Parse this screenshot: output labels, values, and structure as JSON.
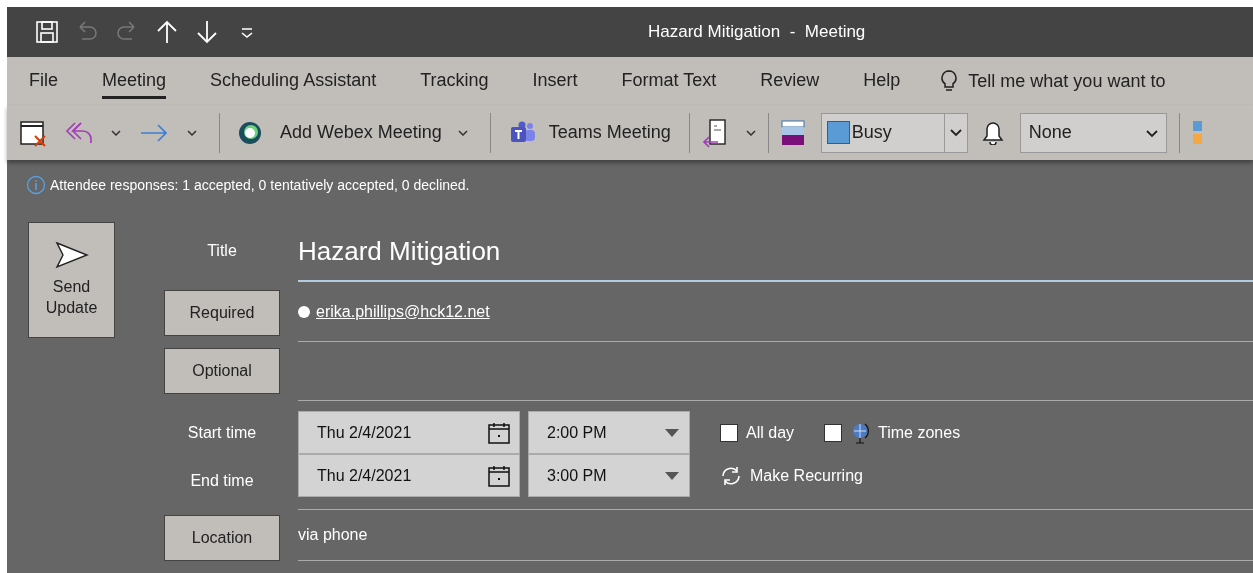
{
  "window": {
    "title": "Hazard Mitigation  -  Meeting"
  },
  "quick_access": [
    {
      "kind": "save",
      "disabled": false
    },
    {
      "kind": "undo",
      "disabled": true
    },
    {
      "kind": "redo",
      "disabled": true
    },
    {
      "kind": "up",
      "disabled": false
    },
    {
      "kind": "down",
      "disabled": false
    },
    {
      "kind": "customize",
      "disabled": false
    }
  ],
  "tabs": [
    {
      "label": "File",
      "selected": false
    },
    {
      "label": "Meeting",
      "selected": true
    },
    {
      "label": "Scheduling Assistant",
      "selected": false
    },
    {
      "label": "Tracking",
      "selected": false
    },
    {
      "label": "Insert",
      "selected": false
    },
    {
      "label": "Format Text",
      "selected": false
    },
    {
      "label": "Review",
      "selected": false
    },
    {
      "label": "Help",
      "selected": false
    }
  ],
  "tell_me": {
    "placeholder": "Tell me what you want to"
  },
  "toolbar": {
    "webex_label": "Add Webex Meeting",
    "teams_label": "Teams Meeting",
    "show_as": {
      "value": "Busy",
      "color": "#5b9bd5"
    },
    "reminder": {
      "value": "None"
    }
  },
  "info_bar": {
    "text": "Attendee responses: 1 accepted, 0 tentatively accepted, 0 declined."
  },
  "form": {
    "send_button": "Send Update",
    "title_label": "Title",
    "title_value": "Hazard Mitigation",
    "required_button": "Required",
    "attendees": [
      "erika.phillips@hck12.net"
    ],
    "optional_button": "Optional",
    "start_label": "Start time",
    "start_date": "Thu 2/4/2021",
    "start_time": "2:00 PM",
    "end_label": "End time",
    "end_date": "Thu 2/4/2021",
    "end_time": "3:00 PM",
    "options": [
      {
        "label": "All day",
        "checked": false,
        "kind": "plain"
      },
      {
        "label": "Time zones",
        "checked": false,
        "kind": "globe"
      }
    ],
    "recurring": "Make Recurring",
    "location_button": "Location",
    "location_value": "via phone"
  }
}
